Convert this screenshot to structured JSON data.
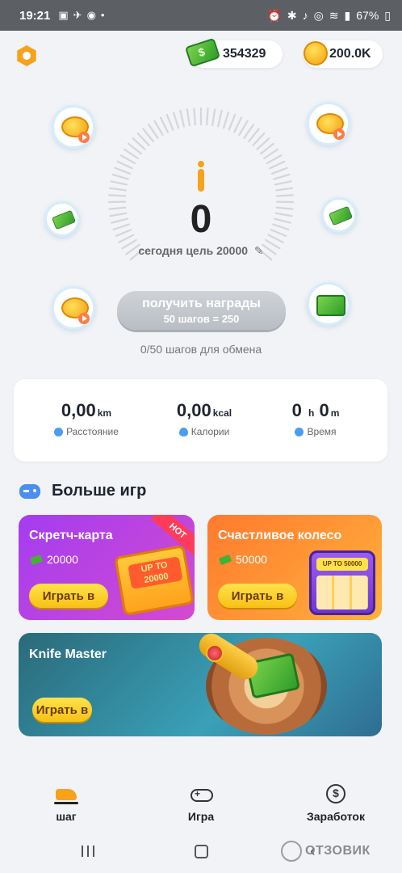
{
  "status_bar": {
    "time": "19:21",
    "battery": "67%"
  },
  "header": {
    "cash_balance": "354329",
    "coin_balance": "200.0K"
  },
  "steps": {
    "count": "0",
    "goal_text": "сегодня цель 20000",
    "edit_icon": "✎"
  },
  "rewards": {
    "button_label": "получить награды",
    "button_sub": "50 шагов = 250",
    "exchange_note": "0/50 шагов для обмена"
  },
  "stats": {
    "distance": {
      "value": "0,00",
      "unit": "km",
      "label": "Расстояние"
    },
    "calories": {
      "value": "0,00",
      "unit": "kcal",
      "label": "Калории"
    },
    "time": {
      "hours": "0",
      "h_unit": "h",
      "minutes": "0",
      "m_unit": "m",
      "label": "Время"
    }
  },
  "more_games": {
    "title": "Больше игр",
    "cards": [
      {
        "title": "Скретч-карта",
        "prize": "20000",
        "play_label": "Играть в",
        "badge": "HOT",
        "art_text": "UP TO 20000"
      },
      {
        "title": "Счастливое колесо",
        "prize": "50000",
        "play_label": "Играть в",
        "art_text": "UP TO 50000"
      },
      {
        "title": "Knife Master",
        "play_label": "Играть в"
      }
    ]
  },
  "bottom_nav": {
    "items": [
      {
        "label": "шаг",
        "icon": "sneaker-icon"
      },
      {
        "label": "Игра",
        "icon": "gamepad-icon"
      },
      {
        "label": "Заработок",
        "icon": "dollar-circle-icon"
      }
    ]
  },
  "watermark": "ОТЗОВИК",
  "colors": {
    "accent_orange": "#f7a21b",
    "cash_green": "#43b233",
    "scratch_purple": "#a33df0",
    "wheel_orange": "#ff7a2e",
    "button_grey": "#c4c8cd"
  }
}
